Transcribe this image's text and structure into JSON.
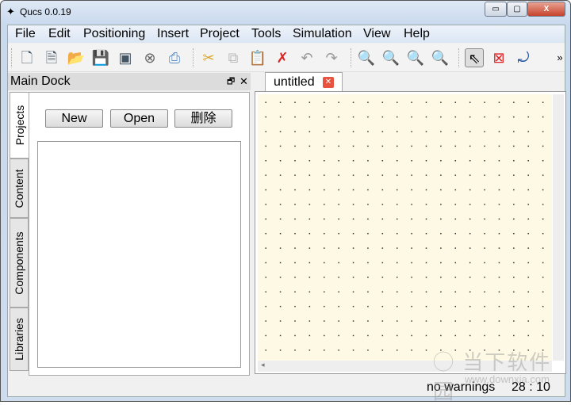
{
  "window": {
    "title": "Qucs 0.0.19"
  },
  "menu": [
    "File",
    "Edit",
    "Positioning",
    "Insert",
    "Project",
    "Tools",
    "Simulation",
    "View",
    "Help"
  ],
  "toolbar": {
    "icons": [
      "new-file",
      "new-text",
      "open",
      "save",
      "save-all",
      "close",
      "print",
      "cut",
      "copy",
      "paste",
      "delete",
      "undo",
      "redo",
      "zoom-fit",
      "zoom-1-1",
      "zoom-in",
      "zoom-out",
      "select",
      "deactivate",
      "insert-port"
    ],
    "overflow": "»"
  },
  "dock": {
    "title": "Main Dock",
    "tabs": [
      "Projects",
      "Content",
      "Components",
      "Libraries"
    ],
    "buttons": {
      "new": "New",
      "open": "Open",
      "delete": "删除"
    }
  },
  "editor": {
    "tab": "untitled"
  },
  "status": {
    "warnings": "no warnings",
    "position": "28 : 10"
  },
  "watermark": {
    "name": "当下软件园",
    "url": "www.downxia.com"
  }
}
